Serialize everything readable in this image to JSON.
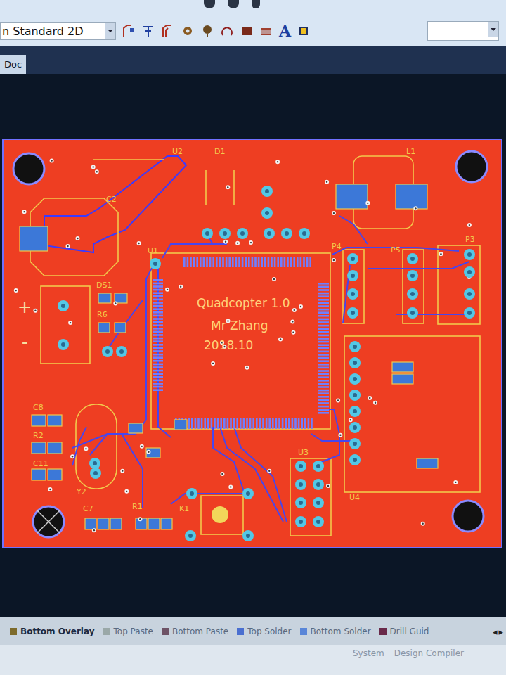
{
  "toolbar": {
    "view_mode": "n Standard 2D",
    "text_tool": "A"
  },
  "document_tab": {
    "label": "Doc",
    "selected": true
  },
  "board": {
    "silkscreen_title": [
      "Quadcopter 1.0",
      "Mr Zhang",
      "2018.10"
    ],
    "designators": [
      "U2",
      "D1",
      "L1",
      "C2",
      "DS1",
      "R6",
      "U1",
      "P4",
      "P5",
      "P3",
      "+",
      "-",
      "C8",
      "R2",
      "C11",
      "Y2",
      "C7",
      "R1",
      "K1",
      "U3",
      "U4"
    ]
  },
  "layer_tabs": [
    {
      "label": "Bottom Overlay",
      "selected": true,
      "color": "#7d6b2c"
    },
    {
      "label": "Top Paste",
      "selected": false,
      "color": "#9aa8a8"
    },
    {
      "label": "Bottom Paste",
      "selected": false,
      "color": "#6e5366"
    },
    {
      "label": "Top Solder",
      "selected": false,
      "color": "#4a6fd0"
    },
    {
      "label": "Bottom Solder",
      "selected": false,
      "color": "#5a86d8"
    },
    {
      "label": "Drill Guid",
      "selected": false,
      "color": "#6a2a4a"
    }
  ],
  "scroll_arrows": [
    "◂",
    "▸"
  ],
  "status_bar": {
    "items": [
      "System",
      "Design Compiler"
    ]
  }
}
